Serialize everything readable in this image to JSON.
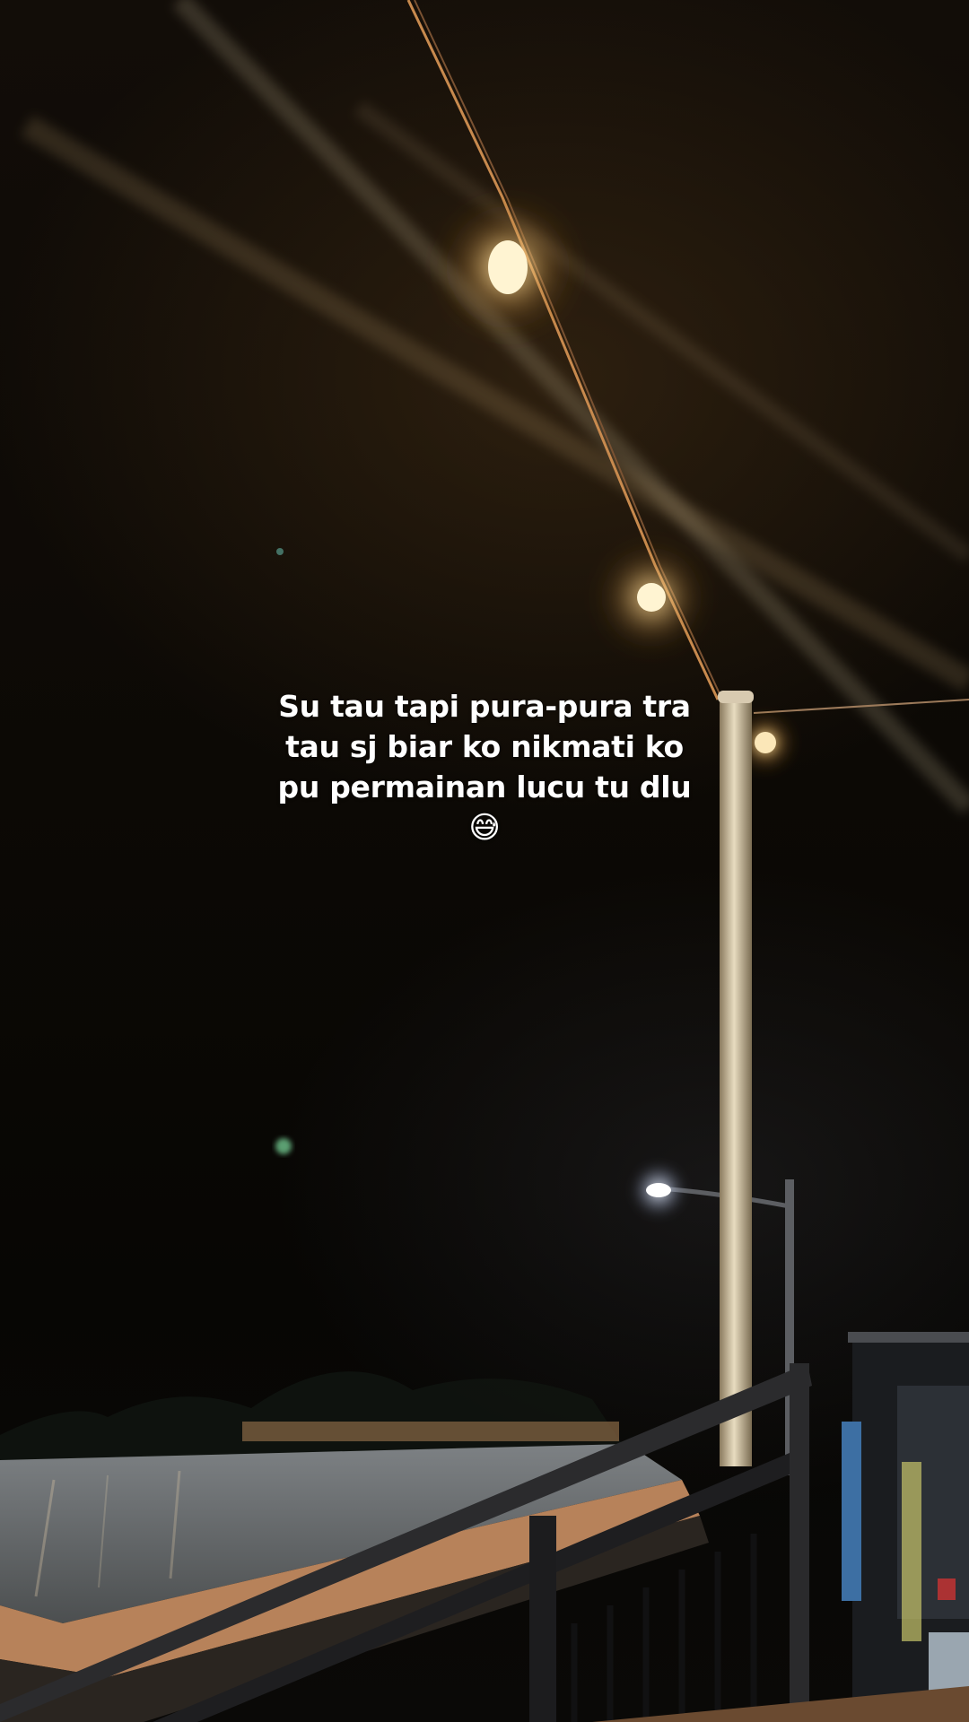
{
  "caption": {
    "line1": "Su tau tapi pura-pura tra",
    "line2": "tau sj biar ko nikmati ko",
    "line3": "pu permainan lucu tu dlu",
    "emoji": "😅"
  }
}
